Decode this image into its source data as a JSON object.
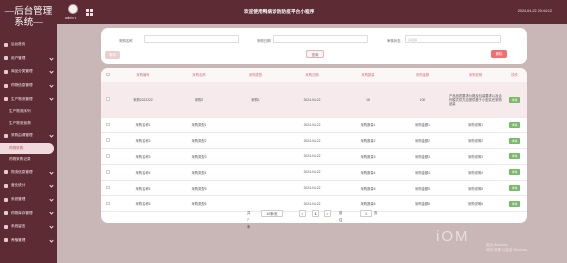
{
  "sidebar": {
    "title_line1": "—后台管理",
    "title_line2": "系统—",
    "items": [
      {
        "label": "后台首页",
        "level": 0
      },
      {
        "label": "用户管理",
        "level": 0
      },
      {
        "label": "商品分类管理",
        "level": 0
      },
      {
        "label": "药物信息管理",
        "level": 0
      },
      {
        "label": "生产物流管理",
        "level": 0
      },
      {
        "label": "生产物流序列",
        "level": 1
      },
      {
        "label": "生产物流追溯",
        "level": 1
      },
      {
        "label": "采购由请管理",
        "level": 0
      },
      {
        "label": "药物采购",
        "level": 1,
        "active": true
      },
      {
        "label": "药物采购记录",
        "level": 1
      },
      {
        "label": "物流信息管理",
        "level": 0
      },
      {
        "label": "营业统计",
        "level": 0
      },
      {
        "label": "系统管理",
        "level": 0
      },
      {
        "label": "药物库存管理",
        "level": 0
      },
      {
        "label": "系统留言",
        "level": 0
      },
      {
        "label": "养殖管理",
        "level": 0
      }
    ]
  },
  "topbar": {
    "username": "admin ▾",
    "title": "欢迎使用鸭病诊防防疫平台小程序",
    "clock": "2024-04-22 20:44:12"
  },
  "search": {
    "field1_label": "采购名称",
    "field1_placeholder": "",
    "field2_label": "采购日期",
    "field2_placeholder": "",
    "field3_label": "审核状态",
    "field3_placeholder": "请选择",
    "search_button": "查询",
    "add_button": "新增",
    "delete_button": "删除"
  },
  "table": {
    "columns": [
      "采购编号",
      "采购名称",
      "采购类型",
      "采购日期",
      "采购数量",
      "采购金额",
      "采购说明",
      "操作"
    ],
    "rows": [
      [
        "采购2222222",
        "采购2",
        "采购1",
        "2024-04-22",
        "18",
        "100",
        "产品品质要求价格及包装要求以及合作模式供方应提供基于小型实在采购品量",
        "详情"
      ],
      [
        "采购名称1",
        "采购类型1",
        "",
        "2024-04-22",
        "采购数量1",
        "采购金额1",
        "采购说明1",
        "详情"
      ],
      [
        "采购名称2",
        "采购类型2",
        "",
        "2024-04-22",
        "采购数量2",
        "采购金额2",
        "采购说明2",
        "详情"
      ],
      [
        "采购名称3",
        "采购类型3",
        "",
        "2024-04-22",
        "采购数量3",
        "采购金额3",
        "采购说明3",
        "详情"
      ],
      [
        "采购名称4",
        "采购类型4",
        "",
        "2024-04-22",
        "采购数量4",
        "采购金额4",
        "采购说明4",
        "详情"
      ],
      [
        "采购名称5",
        "采购类型5",
        "",
        "2024-04-22",
        "采购数量5",
        "采购金额5",
        "采购说明5",
        "详情"
      ],
      [
        "采购名称6",
        "采购类型6",
        "",
        "2024-04-22",
        "采购数量6",
        "采购金额6",
        "采购说明6",
        "详情"
      ]
    ]
  },
  "pager": {
    "total": "共 7 条",
    "page_size": "10条/页",
    "prev": "<",
    "current": "1",
    "next": ">",
    "goto_label": "前往",
    "goto_value": "1",
    "goto_suffix": "页"
  },
  "watermark": {
    "big": "iOM",
    "line1": "激活 Windows",
    "line2": "转到\"设置\"以激活 Windows。"
  },
  "colors": {
    "sidebar": "#5d2b34",
    "accent": "#d46f78",
    "page_bg": "#c9b7b8"
  }
}
